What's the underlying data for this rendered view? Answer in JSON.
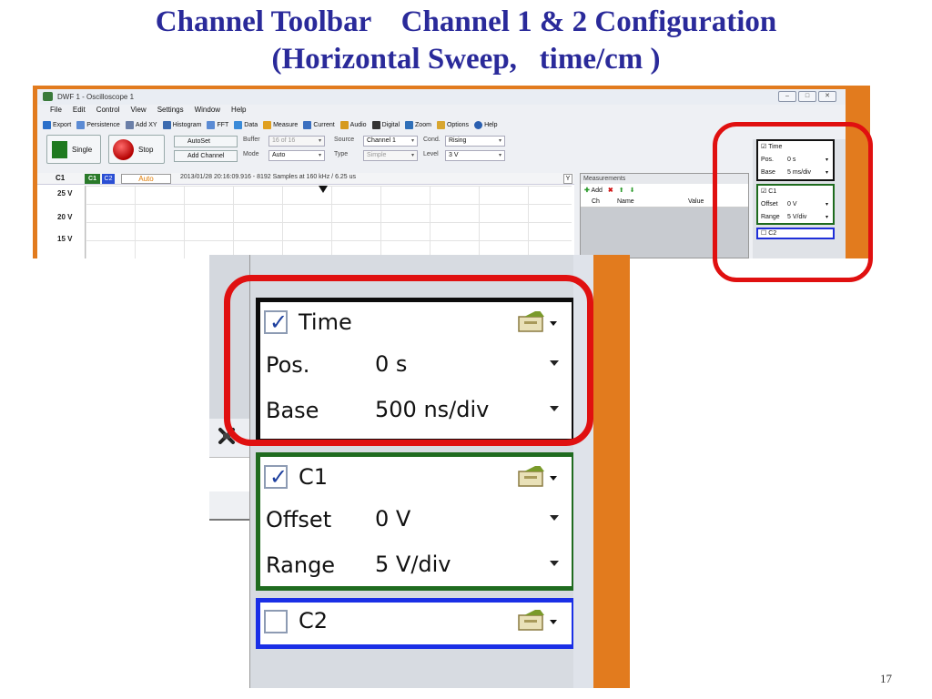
{
  "slide": {
    "title_line1": "Channel Toolbar    Channel 1 & 2 Configuration",
    "title_line2": "(Horizontal Sweep,   time/cm )",
    "page_number": "17"
  },
  "window": {
    "title": "DWF 1 - Oscilloscope 1",
    "controls": [
      "–",
      "□",
      "✕"
    ]
  },
  "menu": [
    "File",
    "Edit",
    "Control",
    "View",
    "Settings",
    "Window",
    "Help"
  ],
  "toolbar": {
    "items": [
      {
        "label": "Export",
        "color": "#2a6fc9"
      },
      {
        "label": "Persistence",
        "color": "#5b8bd4"
      },
      {
        "label": "Add XY",
        "color": "#6a7fa8"
      },
      {
        "label": "Histogram",
        "color": "#3c6bb0"
      },
      {
        "label": "FFT",
        "color": "#5b8bd4"
      },
      {
        "label": "Data",
        "color": "#3a8ad8"
      },
      {
        "label": "Measure",
        "color": "#e0a020"
      },
      {
        "label": "Current",
        "color": "#3a6fc0"
      },
      {
        "label": "Audio",
        "color": "#d69a1c"
      },
      {
        "label": "Digital",
        "color": "#333333"
      },
      {
        "label": "Zoom",
        "color": "#2f6fb8"
      },
      {
        "label": "Options",
        "color": "#d8a630"
      },
      {
        "label": "Help",
        "color": "#2a5fb0"
      }
    ]
  },
  "acquisition": {
    "single_label": "Single",
    "stop_label": "Stop",
    "autoset_label": "AutoSet",
    "add_channel_label": "Add Channel",
    "buffer_label": "Buffer",
    "buffer_value": "16 of 16",
    "mode_label": "Mode",
    "mode_value": "Auto",
    "source_label": "Source",
    "source_value": "Channel 1",
    "type_label": "Type",
    "type_value": "Simple",
    "cond_label": "Cond.",
    "cond_value": "Rising",
    "level_label": "Level",
    "level_value": "3 V"
  },
  "scope": {
    "channel_label": "C1",
    "c1_pill": "C1",
    "c2_pill": "C2",
    "auto_label": "Auto",
    "acq_info": "2013/01/28 20:16:09.916 - 8192 Samples at 160 kHz / 6.25 us",
    "y_button": "Y",
    "volt_labels": [
      "25 V",
      "20 V",
      "15 V"
    ]
  },
  "measurements": {
    "title": "Measurements",
    "add_label": "Add",
    "columns": [
      "Ch",
      "Name",
      "Value"
    ]
  },
  "mini_panel": {
    "time_label": "Time",
    "pos_label": "Pos.",
    "pos_value": "0 s",
    "base_label": "Base",
    "base_value": "5 ms/div",
    "c1_label": "C1",
    "offset_label": "Offset",
    "offset_value": "0 V",
    "range_label": "Range",
    "range_value": "5 V/div",
    "c2_label": "C2"
  },
  "zoom_panel": {
    "time_label": "Time",
    "pos_label": "Pos.",
    "pos_value": "0 s",
    "base_label": "Base",
    "base_value": "500 ns/div",
    "c1_label": "C1",
    "offset_label": "Offset",
    "offset_value": "0 V",
    "range_label": "Range",
    "range_value": "5 V/div",
    "c2_label": "C2",
    "checkmark": "✓"
  },
  "colors": {
    "title_blue": "#2a2a9a",
    "highlight_red": "#e01010",
    "frame_orange": "#e27b1e",
    "c1_green": "#1f6b1f",
    "c2_blue": "#1a2fe6"
  }
}
